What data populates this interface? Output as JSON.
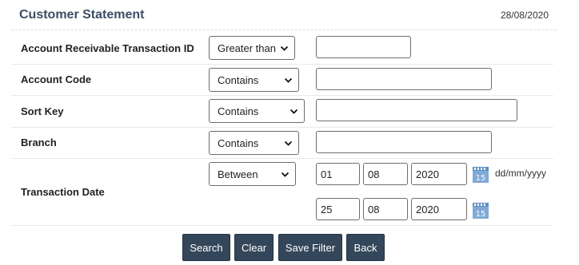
{
  "header": {
    "title": "Customer Statement",
    "date": "28/08/2020"
  },
  "filters": {
    "ar_transaction_id": {
      "label": "Account Receivable Transaction ID",
      "operator": "Greater than",
      "value": ""
    },
    "account_code": {
      "label": "Account Code",
      "operator": "Contains",
      "value": ""
    },
    "sort_key": {
      "label": "Sort Key",
      "operator": "Contains",
      "value": ""
    },
    "branch": {
      "label": "Branch",
      "operator": "Contains",
      "value": ""
    },
    "transaction_date": {
      "label": "Transaction Date",
      "operator": "Between",
      "from": {
        "day": "01",
        "month": "08",
        "year": "2020"
      },
      "to": {
        "day": "25",
        "month": "08",
        "year": "2020"
      },
      "format_hint": "dd/mm/yyyy",
      "calendar_day_label": "15"
    }
  },
  "actions": {
    "search": "Search",
    "clear": "Clear",
    "save_filter": "Save Filter",
    "back": "Back"
  },
  "icons": {
    "dropdown": "chevron-down-icon",
    "calendar": "calendar-icon"
  },
  "colors": {
    "title": "#3b4e63",
    "button_bg": "#34475a",
    "calendar": "#7fa9d6"
  }
}
